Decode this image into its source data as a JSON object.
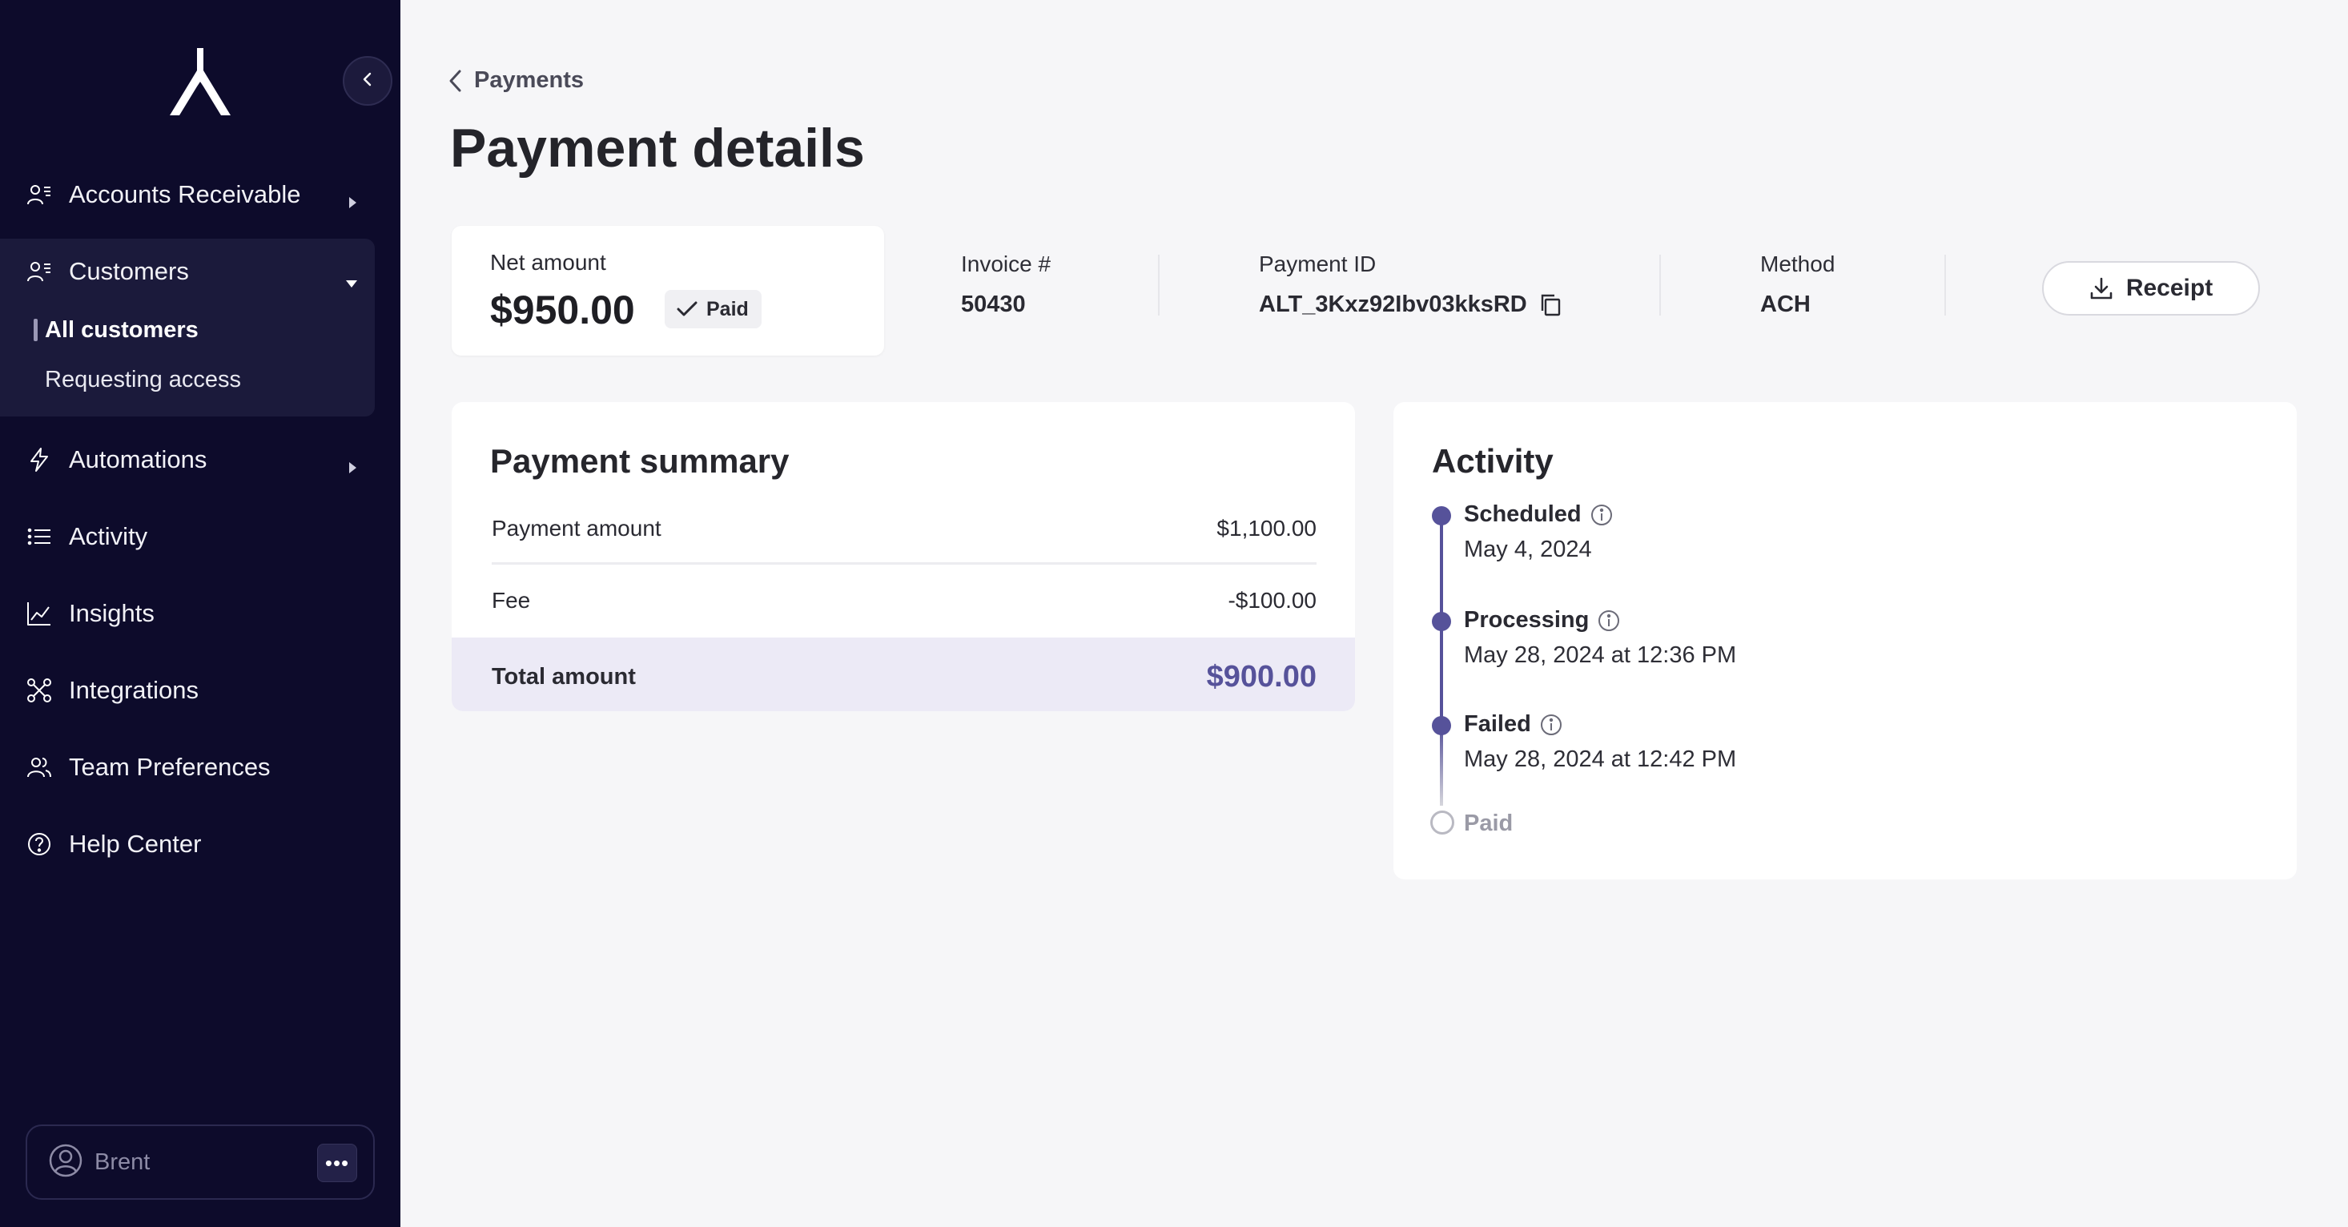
{
  "sidebar": {
    "nav": [
      {
        "label": "Accounts Receivable",
        "icon": "users-list-icon"
      },
      {
        "label": "Customers",
        "icon": "users-list-icon"
      },
      {
        "label": "Automations",
        "icon": "bolt-icon"
      },
      {
        "label": "Activity",
        "icon": "list-icon"
      },
      {
        "label": "Insights",
        "icon": "chart-line-icon"
      },
      {
        "label": "Integrations",
        "icon": "nodes-icon"
      },
      {
        "label": "Team Preferences",
        "icon": "team-icon"
      },
      {
        "label": "Help Center",
        "icon": "help-icon"
      }
    ],
    "customers_sub": [
      {
        "label": "All customers"
      },
      {
        "label": "Requesting access"
      }
    ],
    "user": {
      "name": "Brent"
    }
  },
  "breadcrumb": {
    "label": "Payments"
  },
  "page": {
    "title": "Payment details"
  },
  "net": {
    "label": "Net amount",
    "value": "$950.00",
    "status": "Paid"
  },
  "meta": {
    "invoice_label": "Invoice #",
    "invoice_value": "50430",
    "payment_id_label": "Payment ID",
    "payment_id_value": "ALT_3Kxz92Ibv03kksRD",
    "method_label": "Method",
    "method_value": "ACH"
  },
  "receipt_button": {
    "label": "Receipt"
  },
  "summary": {
    "title": "Payment summary",
    "rows": [
      {
        "label": "Payment amount",
        "value": "$1,100.00"
      },
      {
        "label": "Fee",
        "value": "-$100.00"
      }
    ],
    "total_label": "Total amount",
    "total_value": "$900.00"
  },
  "activity": {
    "title": "Activity",
    "events": [
      {
        "title": "Scheduled",
        "date": "May 4, 2024"
      },
      {
        "title": "Processing",
        "date": "May 28, 2024 at 12:36 PM"
      },
      {
        "title": "Failed",
        "date": "May 28, 2024 at 12:42 PM"
      },
      {
        "title": "Paid",
        "date": ""
      }
    ]
  },
  "colors": {
    "sidebar_bg": "#0d0b2b",
    "accent": "#56529a",
    "page_bg": "#f6f6f8"
  }
}
